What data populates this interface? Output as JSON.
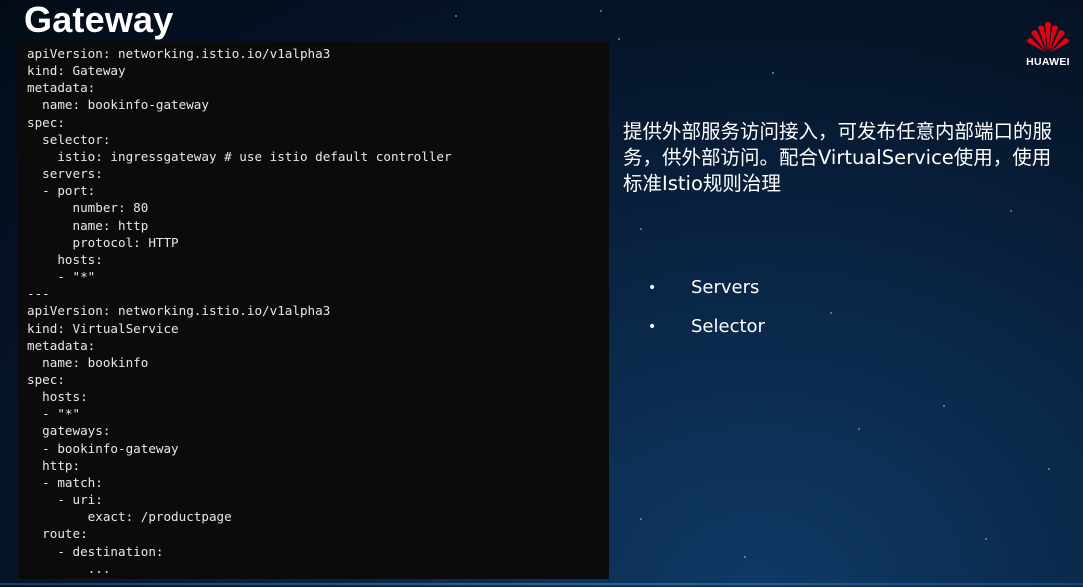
{
  "title": "Gateway",
  "code": "apiVersion: networking.istio.io/v1alpha3\nkind: Gateway\nmetadata:\n  name: bookinfo-gateway\nspec:\n  selector:\n    istio: ingressgateway # use istio default controller\n  servers:\n  - port:\n      number: 80\n      name: http\n      protocol: HTTP\n    hosts:\n    - \"*\"\n---\napiVersion: networking.istio.io/v1alpha3\nkind: VirtualService\nmetadata:\n  name: bookinfo\nspec:\n  hosts:\n  - \"*\"\n  gateways:\n  - bookinfo-gateway\n  http:\n  - match:\n    - uri:\n        exact: /productpage\n  route:\n    - destination:\n        ...",
  "description": "提供外部服务访问接入，可发布任意内部端口的服务，供外部访问。配合VirtualService使用，使用标准Istio规则治理",
  "bullets": [
    "Servers",
    "Selector"
  ],
  "bullet_symbol": "•",
  "logo": {
    "text": "HUAWEI",
    "color": "#e60012",
    "icon": "huawei-logo-icon"
  }
}
